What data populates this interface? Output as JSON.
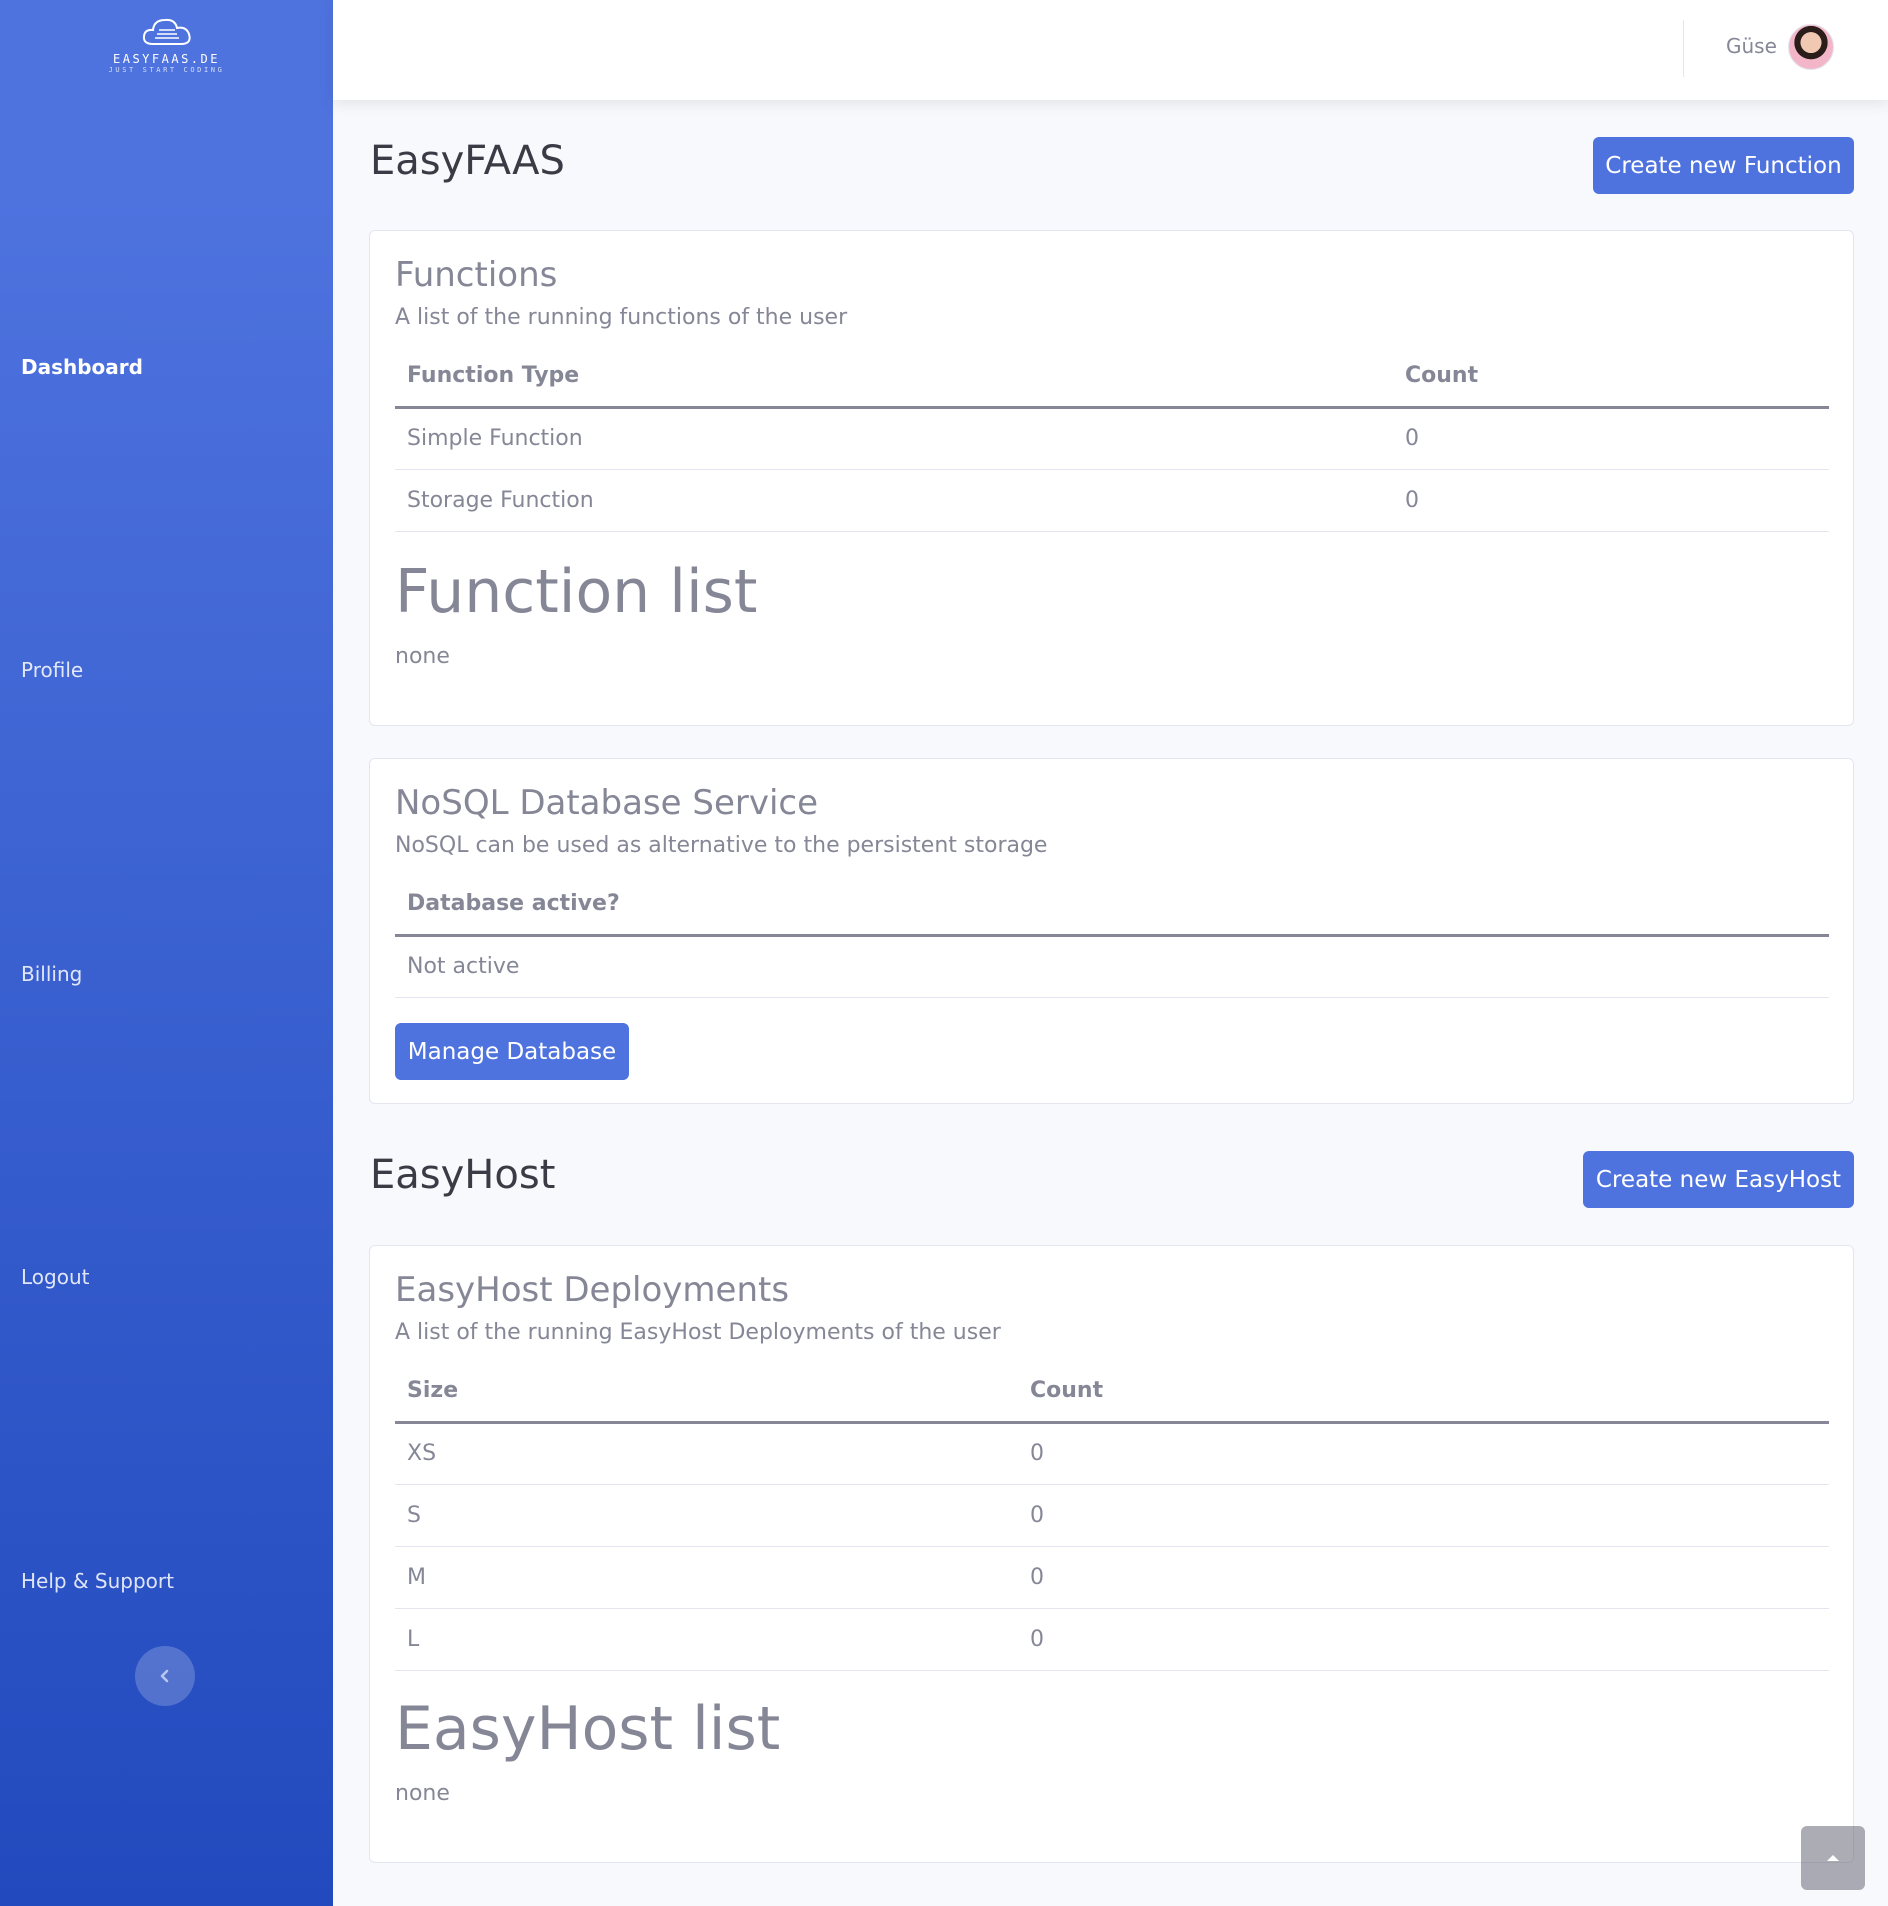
{
  "brand": {
    "name": "EASYFAAS.DE",
    "tagline": "JUST START CODING"
  },
  "sidebar": {
    "items": [
      {
        "label": "Dashboard",
        "active": true
      },
      {
        "label": "Profile"
      },
      {
        "label": "Billing"
      },
      {
        "label": "Logout"
      },
      {
        "label": "Help & Support"
      }
    ],
    "toggle_icon": "chevron-left-icon"
  },
  "topbar": {
    "user_name": "Güse"
  },
  "easyfaas": {
    "title": "EasyFAAS",
    "create_label": "Create new Function",
    "functions_card": {
      "title": "Functions",
      "subtitle": "A list of the running functions of the user",
      "headers": [
        "Function Type",
        "Count"
      ],
      "rows": [
        [
          "Simple Function",
          "0"
        ],
        [
          "Storage Function",
          "0"
        ]
      ],
      "list_heading": "Function list",
      "list_value": "none"
    },
    "nosql_card": {
      "title": "NoSQL Database Service",
      "subtitle": "NoSQL can be used as alternative to the persistent storage",
      "header": "Database active?",
      "value": "Not active",
      "button_label": "Manage Database"
    }
  },
  "easyhost": {
    "title": "EasyHost",
    "create_label": "Create new EasyHost",
    "deployments_card": {
      "title": "EasyHost Deployments",
      "subtitle": "A list of the running EasyHost Deployments of the user",
      "headers": [
        "Size",
        "Count"
      ],
      "rows": [
        [
          "XS",
          "0"
        ],
        [
          "S",
          "0"
        ],
        [
          "M",
          "0"
        ],
        [
          "L",
          "0"
        ]
      ],
      "list_heading": "EasyHost list",
      "list_value": "none"
    }
  },
  "colors": {
    "primary": "#4e73df",
    "sidebar_end": "#224abe",
    "text": "#858796",
    "heading": "#3a3b45"
  }
}
